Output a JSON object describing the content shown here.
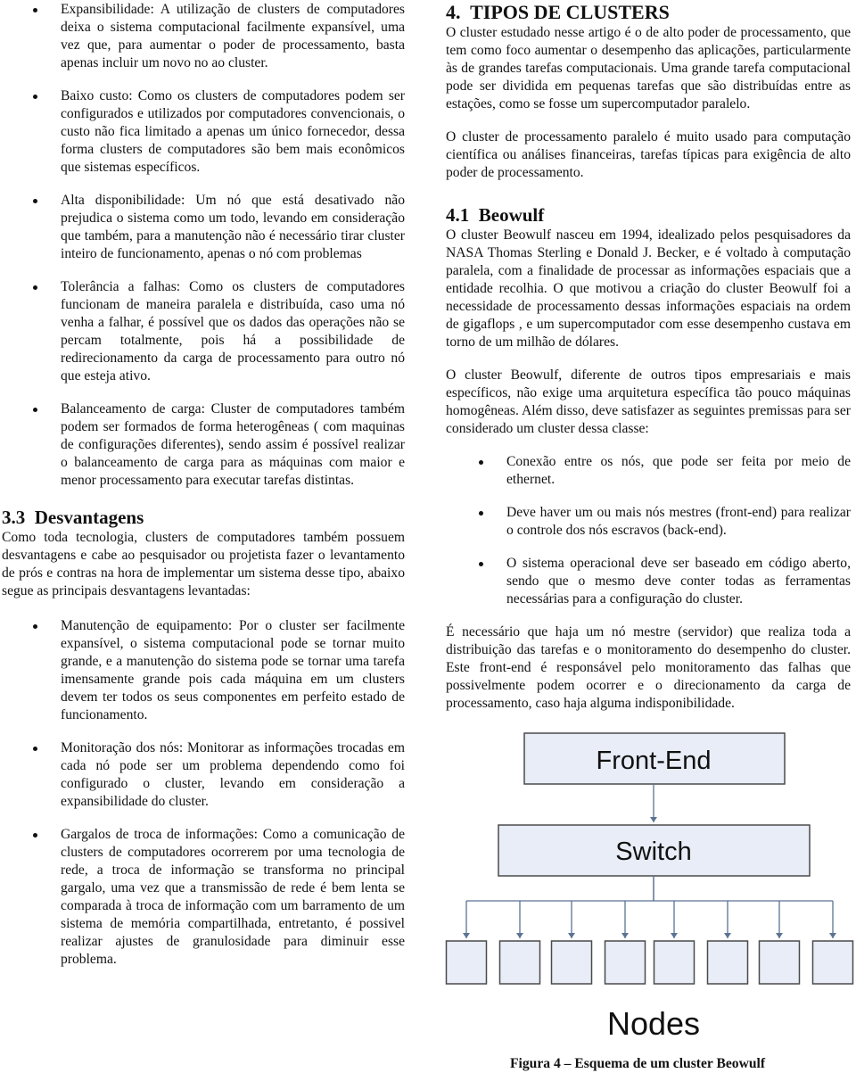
{
  "left_column": {
    "advantages": [
      {
        "text": "Expansibilidade: A utilização de clusters de computadores deixa o sistema computacional facilmente expansível, uma vez que, para aumentar o poder de processamento, basta apenas incluir um novo no ao cluster."
      },
      {
        "text": "Baixo custo: Como os clusters de computadores podem ser configurados e utilizados por computadores convencionais, o custo não fica limitado a apenas um único fornecedor, dessa forma clusters de computadores são bem mais econômicos que sistemas específicos."
      },
      {
        "text": "Alta disponibilidade: Um nó que está desativado não prejudica o sistema como um todo, levando em consideração que também, para a manutenção não é necessário tirar cluster inteiro de funcionamento, apenas o nó com problemas"
      },
      {
        "text": "Tolerância a falhas: Como os clusters de computadores funcionam de maneira paralela e distribuída, caso uma nó venha a falhar, é possível que os dados das operações não se percam totalmente, pois há a possibilidade de redirecionamento da carga de processamento para outro nó que esteja ativo."
      },
      {
        "text": "Balanceamento de carga: Cluster de computadores também podem ser formados de forma heterogêneas ( com maquinas de configurações diferentes), sendo assim é possível realizar o balanceamento de carga para as máquinas com maior e menor processamento para executar tarefas distintas."
      }
    ],
    "section_3_3": {
      "heading": "3.3  Desvantagens",
      "intro": "Como toda tecnologia, clusters de computadores também possuem desvantagens e cabe ao pesquisador ou projetista fazer o levantamento de prós e contras na hora de implementar um sistema desse tipo, abaixo segue as principais desvantagens levantadas:",
      "items": [
        {
          "text": "Manutenção de equipamento: Por o cluster ser facilmente expansível, o sistema computacional pode se tornar muito grande, e a manutenção do sistema pode se tornar uma tarefa imensamente grande pois cada máquina em um clusters devem ter todos os seus componentes em perfeito estado de funcionamento."
        },
        {
          "text": "Monitoração dos nós: Monitorar as informações trocadas em cada nó pode ser um problema dependendo como foi configurado o cluster, levando em consideração a expansibilidade do cluster."
        },
        {
          "text": "Gargalos de troca de informações: Como a comunicação de clusters de computadores ocorrerem por uma tecnologia de rede, a troca de informação se transforma no principal gargalo, uma vez que a transmissão de rede é bem lenta se comparada à troca de informação com um barramento de um sistema de memória compartilhada, entretanto, é possivel realizar ajustes de granulosidade para diminuir esse problema."
        }
      ]
    }
  },
  "right_column": {
    "section_4": {
      "heading": "4.  TIPOS DE CLUSTERS",
      "paragraphs": [
        "O cluster estudado nesse artigo é o de alto poder de processamento, que tem como foco aumentar o desempenho das aplicações, particularmente às de grandes tarefas computacionais. Uma grande tarefa computacional pode ser dividida em pequenas tarefas que são distribuídas entre as estações, como se fosse um supercomputador paralelo.",
        "O cluster de processamento paralelo é muito usado para computação científica ou análises financeiras, tarefas típicas para exigência de alto poder de processamento."
      ]
    },
    "section_4_1": {
      "heading": "4.1  Beowulf",
      "paragraphs": [
        "O cluster Beowulf nasceu em 1994, idealizado pelos pesquisadores da NASA Thomas Sterling e Donald J. Becker, e é voltado à computação paralela, com a finalidade de processar as informações espaciais que a entidade recolhia. O que motivou a criação do cluster Beowulf foi a necessidade de processamento dessas informações espaciais na ordem de gigaflops , e um supercomputador com esse desempenho custava em torno de um milhão de dólares.",
        "O cluster Beowulf, diferente de outros tipos empresariais e mais específicos, não exige uma arquitetura específica tão pouco máquinas homogêneas. Além disso, deve satisfazer as seguintes premissas para ser considerado um cluster dessa classe:"
      ],
      "requirements": [
        {
          "text": "Conexão entre os nós, que pode ser feita por meio de ethernet."
        },
        {
          "text": "Deve haver um ou mais nós mestres (front-end) para realizar o controle dos nós escravos (back-end)."
        },
        {
          "text": "O sistema operacional deve ser baseado em código aberto, sendo que o mesmo deve conter todas as ferramentas necessárias para a configuração do cluster."
        }
      ],
      "closing": "É necessário que haja um nó mestre (servidor) que realiza toda a distribuição das tarefas e o monitoramento do desempenho do cluster. Este front-end é responsável pelo monitoramento das falhas que possivelmente podem ocorrer e o direcionamento da carga de processamento, caso haja alguma indisponibilidade."
    },
    "figure": {
      "front_end_label": "Front-End",
      "switch_label": "Switch",
      "nodes_label": "Nodes",
      "node_count": 8,
      "caption": "Figura 4 – Esquema de um cluster Beowulf",
      "box_fill": "#e8edf8",
      "box_stroke": "#4a4a4a",
      "arrow_color": "#5b7393"
    }
  }
}
